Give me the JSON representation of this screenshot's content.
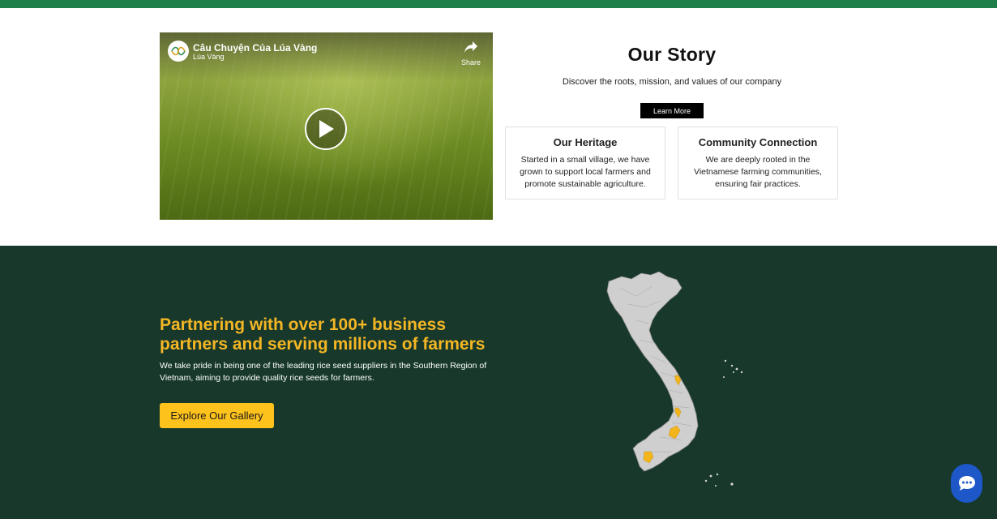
{
  "video": {
    "title": "Câu Chuyện Của Lúa Vàng",
    "channel": "Lúa Vàng",
    "share_label": "Share",
    "logo_icon": "rice-leaf-logo-icon",
    "play_icon": "play-icon",
    "share_icon": "share-arrow-icon"
  },
  "story": {
    "title": "Our Story",
    "subtitle": "Discover the roots, mission, and values of our company",
    "learn_more_label": "Learn More",
    "cards": [
      {
        "title": "Our Heritage",
        "body": "Started in a small village, we have grown to support local farmers and promote sustainable agriculture."
      },
      {
        "title": "Community Connection",
        "body": "We are deeply rooted in the Vietnamese farming communities, ensuring fair practices."
      }
    ]
  },
  "partners": {
    "title": "Partnering with over 100+ business partners and serving millions of farmers",
    "description": "We take pride in being one of the leading rice seed suppliers in the Southern Region of Vietnam, aiming to provide quality rice seeds for farmers.",
    "gallery_label": "Explore Our Gallery",
    "map_icon": "vietnam-map-icon"
  },
  "chat": {
    "icon": "chat-bubble-icon"
  },
  "colors": {
    "top_bar": "#1f7f4b",
    "partners_bg": "#17382a",
    "accent_yellow": "#fec21d",
    "headline_yellow": "#f4b625",
    "chat_blue": "#1d57c8"
  }
}
